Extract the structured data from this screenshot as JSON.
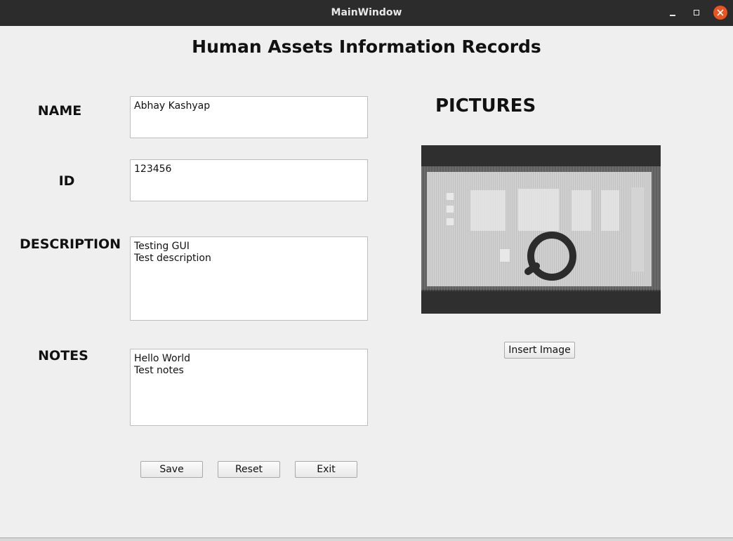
{
  "window": {
    "title": "MainWindow"
  },
  "app_title": "Human Assets Information Records",
  "form": {
    "name": {
      "label": "NAME",
      "lines": [
        "Abhay Kashyap"
      ]
    },
    "id": {
      "label": "ID",
      "lines": [
        "123456"
      ]
    },
    "description": {
      "label": "DESCRIPTION",
      "lines": [
        "Testing GUI",
        "Test description"
      ]
    },
    "notes": {
      "label": "NOTES",
      "lines": [
        "Hello World",
        "Test notes"
      ]
    }
  },
  "pictures": {
    "heading": "PICTURES",
    "insert_label": "Insert Image"
  },
  "buttons": {
    "save": "Save",
    "reset": "Reset",
    "exit": "Exit"
  },
  "colors": {
    "titlebar": "#2c2c2c",
    "close": "#e95420",
    "background": "#efefef"
  }
}
